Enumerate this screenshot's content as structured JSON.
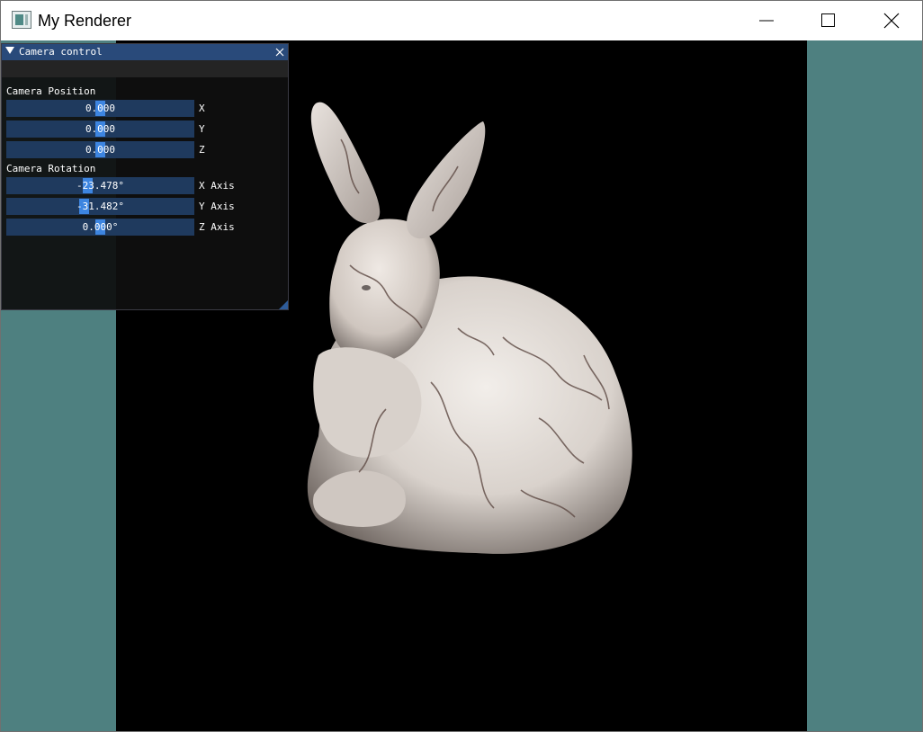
{
  "window": {
    "title": "My Renderer",
    "icons": {
      "app": "app-window-icon",
      "minimize": "minimize-icon",
      "maximize": "maximize-icon",
      "close": "close-icon"
    }
  },
  "colors": {
    "client_background": "#4e8080",
    "viewport_background": "#000000",
    "panel_title_bar": "#294a7a",
    "slider_frame": "#1f3a5e",
    "slider_grab": "#3d85e0"
  },
  "camera_panel": {
    "title": "Camera control",
    "collapse_icon": "triangle-down-icon",
    "close_icon": "close-icon",
    "position_label": "Camera Position",
    "position": [
      {
        "value": "0.000",
        "label": "X",
        "grab": 0.5
      },
      {
        "value": "0.000",
        "label": "Y",
        "grab": 0.5
      },
      {
        "value": "0.000",
        "label": "Z",
        "grab": 0.5
      }
    ],
    "rotation_label": "Camera Rotation",
    "rotation": [
      {
        "value": "-23.478°",
        "label": "X Axis",
        "grab": 0.435
      },
      {
        "value": "-31.482°",
        "label": "Y Axis",
        "grab": 0.413
      },
      {
        "value": "0.000°",
        "label": "Z Axis",
        "grab": 0.5
      }
    ]
  },
  "scene": {
    "object": "marble-textured bunny model"
  }
}
